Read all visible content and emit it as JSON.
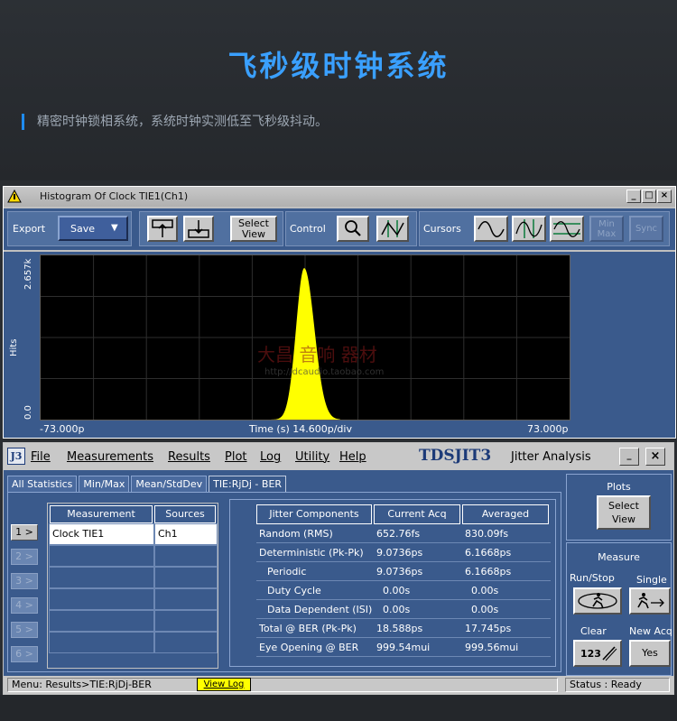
{
  "hero": {
    "title": "飞秒级时钟系统",
    "subtitle": "精密时钟锁相系统，系统时钟实测低至飞秒级抖动。"
  },
  "histogram_window": {
    "title": "Histogram Of Clock TIE1(Ch1)",
    "toolbar": {
      "export_label": "Export",
      "save_label": "Save",
      "select_view_line1": "Select",
      "select_view_line2": "View",
      "control_label": "Control",
      "cursors_label": "Cursors",
      "minmax_line1": "Min",
      "minmax_line2": "Max",
      "sync_label": "Sync"
    },
    "plot": {
      "y_axis_label": "Hits",
      "y_max_label": "2.657k",
      "y_min_label": "0.0",
      "x_min_label": "-73.000p",
      "x_center_label": "Time (s)   14.600p/div",
      "x_max_label": "73.000p",
      "trace_color": "#ffff00"
    },
    "watermark": {
      "line1": "大昌 音响 器材",
      "line2": "http://dcaudio.taobao.com"
    }
  },
  "jitter_window": {
    "menu": [
      "File",
      "Measurements",
      "Results",
      "Plot",
      "Log",
      "Utility",
      "Help"
    ],
    "logo": "J3",
    "brand": "TDSJIT3",
    "brand_sub": "Jitter Analysis",
    "tabs": [
      "All Statistics",
      "Min/Max",
      "Mean/StdDev",
      "TIE:RjDj - BER"
    ],
    "row_buttons": [
      "1 >",
      "2 >",
      "3 >",
      "4 >",
      "5 >",
      "6 >"
    ],
    "measurement_table": {
      "headers": [
        "Measurement",
        "Sources"
      ],
      "rows": [
        [
          "Clock TIE1",
          "Ch1"
        ]
      ]
    },
    "jitter_table": {
      "headers": [
        "Jitter Components",
        "Current Acq",
        "Averaged"
      ],
      "rows": [
        [
          "Random (RMS)",
          "652.76fs",
          "830.09fs"
        ],
        [
          "Deterministic (Pk-Pk)",
          "9.0736ps",
          "6.1668ps"
        ],
        [
          "Periodic",
          "9.0736ps",
          "6.1668ps"
        ],
        [
          "Duty Cycle",
          "0.00s",
          "0.00s"
        ],
        [
          "Data Dependent (ISI)",
          "0.00s",
          "0.00s"
        ],
        [
          "Total @ BER (Pk-Pk)",
          "18.588ps",
          "17.745ps"
        ],
        [
          "Eye Opening @ BER",
          "999.54mui",
          "999.56mui"
        ]
      ]
    },
    "right_panel": {
      "plots_label": "Plots",
      "select_view_line1": "Select",
      "select_view_line2": "View",
      "measure_label": "Measure",
      "run_stop_label": "Run/Stop",
      "single_label": "Single",
      "clear_label": "Clear",
      "new_acq_label": "New Acq",
      "yes_label": "Yes",
      "clear_icon_text": "123"
    },
    "status_bar": {
      "menu_path": "Menu: Results>TIE:RjDj-BER",
      "view_log": "View Log",
      "status": "Status : Ready"
    }
  }
}
